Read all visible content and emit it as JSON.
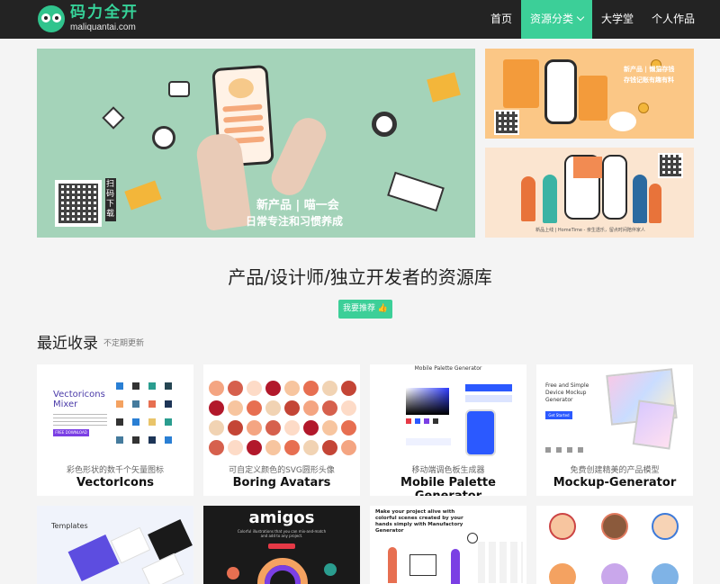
{
  "header": {
    "logo_cn": "码力全开",
    "logo_en": "maliquantai.com",
    "nav": [
      {
        "label": "首页",
        "active": false
      },
      {
        "label": "资源分类",
        "active": true
      },
      {
        "label": "大学堂",
        "active": false
      },
      {
        "label": "个人作品",
        "active": false
      }
    ]
  },
  "banners": {
    "main": {
      "title": "新产品 | 喵一会",
      "subtitle": "日常专注和习惯养成",
      "qr_label": "扫码下载"
    },
    "side1": {
      "title": "新产品 | 懒猫存钱",
      "subtitle": "存钱记账有趣有料"
    },
    "side2": {
      "caption": "新品上线 | HomeTime - 亲生透乐，留点时间陪伴家人"
    }
  },
  "hero": {
    "title": "产品/设计师/独立开发者的资源库",
    "button": "我要推荐 👍"
  },
  "section": {
    "title": "最近收录",
    "subtitle": "不定期更新"
  },
  "cards": [
    {
      "desc": "彩色形状的数千个矢量图标",
      "name": "VectorIcons",
      "thumb_title": "Vectoricons Mixer",
      "thumb_button": "FREE DOWNLOAD"
    },
    {
      "desc": "可自定义颜色的SVG圆形头像",
      "name": "Boring Avatars"
    },
    {
      "desc": "移动端调色板生成器",
      "name": "Mobile Palette Generator",
      "thumb_title": "Mobile Palette Generator"
    },
    {
      "desc": "免费创建精美的产品模型",
      "name": "Mockup-Generator",
      "thumb_title": "Free and Simple Device Mockup Generator",
      "thumb_button": "Get Started"
    },
    {
      "thumb_title": "Templates"
    },
    {
      "thumb_title": "amigos",
      "thumb_sub": "Colorful illustrations that you can mix-and-match and add to any project."
    },
    {
      "thumb_title": "Make your project alive with colorful scenes created by your hands simply with Manufactory Generator"
    },
    {}
  ],
  "colors": {
    "header_bg": "#232323",
    "accent": "#3ccf98",
    "page_bg": "#f4f4f4"
  }
}
